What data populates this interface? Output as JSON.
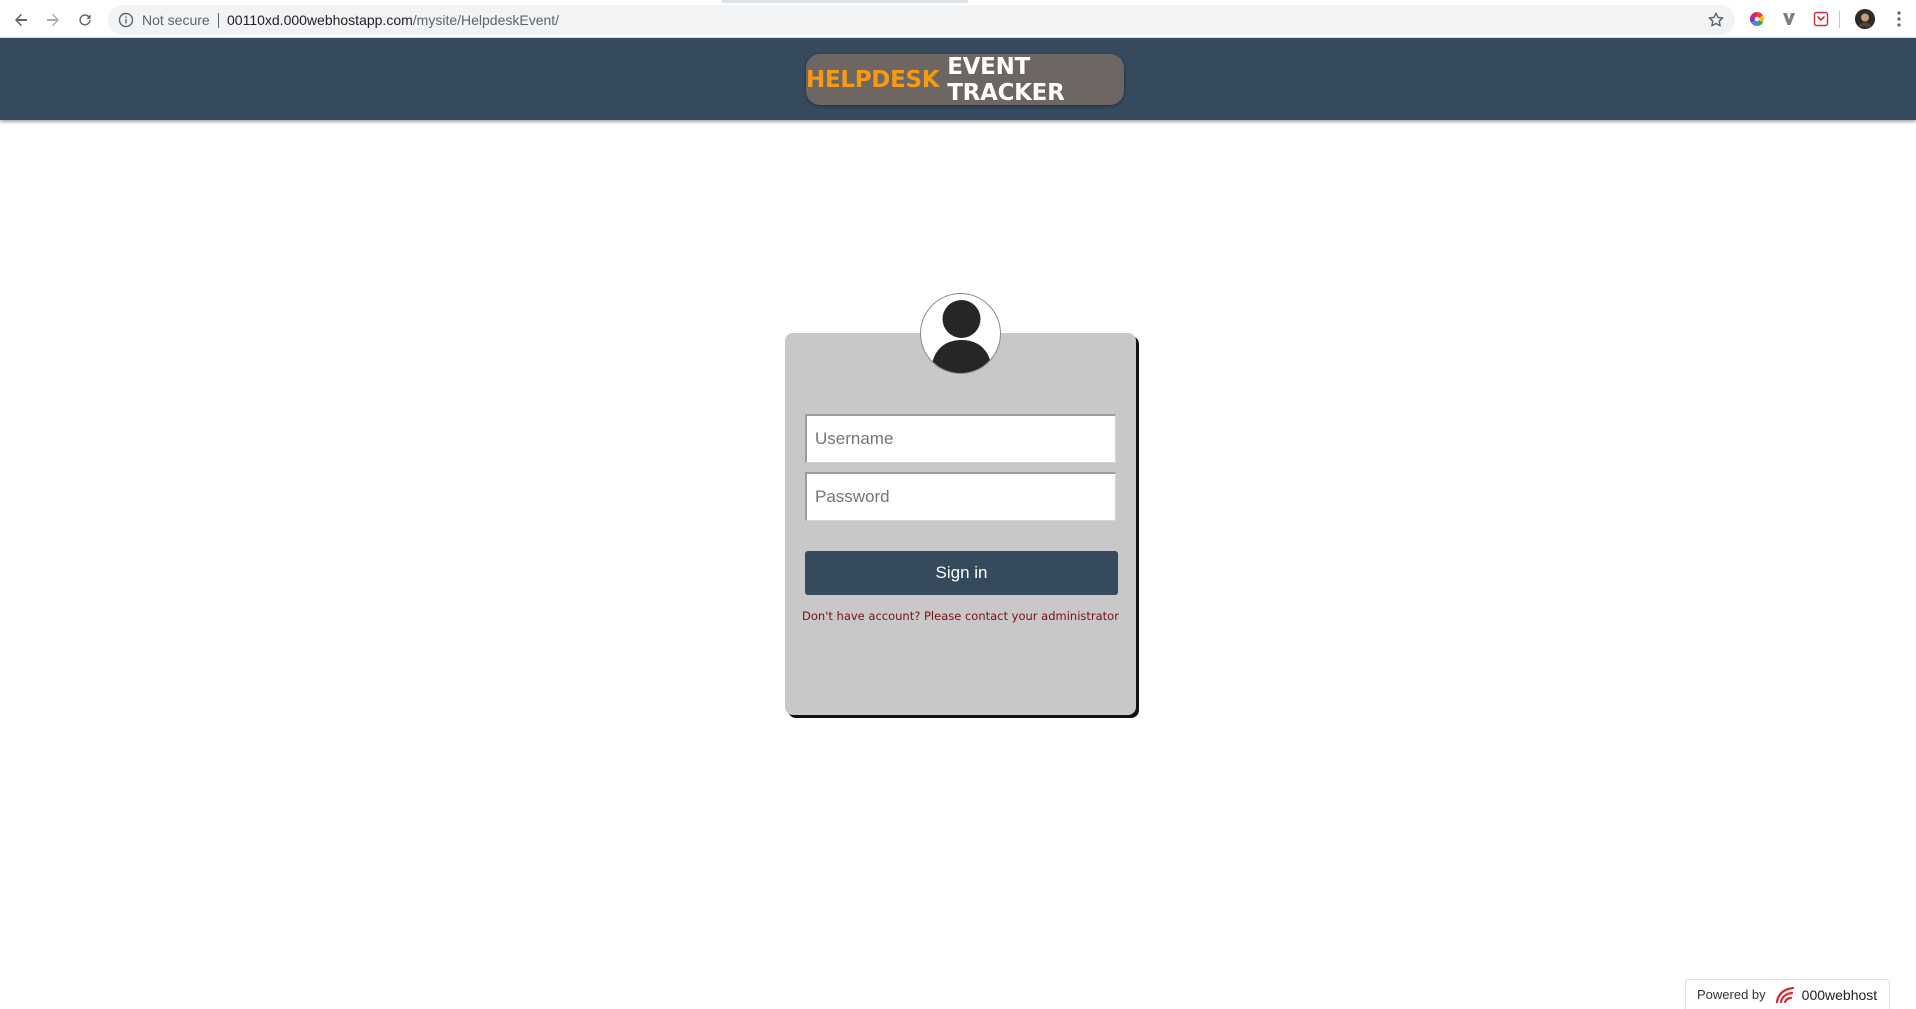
{
  "browser": {
    "security_label": "Not secure",
    "url_host": "00110xd.000webhostapp.com",
    "url_path": "/mysite/HelpdeskEvent/",
    "icons": [
      "back-icon",
      "forward-icon",
      "reload-icon",
      "info-icon",
      "star-icon",
      "color-wheel-extension-icon",
      "v-extension-icon",
      "pocket-extension-icon",
      "profile-avatar",
      "more-menu-icon"
    ]
  },
  "header": {
    "logo_part1": "HELPDESK",
    "logo_part2": "EVENT TRACKER",
    "background_color": "#364a5e",
    "logo_accent_color": "#f59a12"
  },
  "login": {
    "avatar_icon": "user-icon",
    "username_placeholder": "Username",
    "password_placeholder": "Password",
    "signin_label": "Sign in",
    "register_note": "Don't have account? Please contact your administrator",
    "button_color": "#364a5e",
    "card_color": "#c8c8c8"
  },
  "footer_badge": {
    "prefix": "Powered by",
    "brand": "000webhost"
  }
}
